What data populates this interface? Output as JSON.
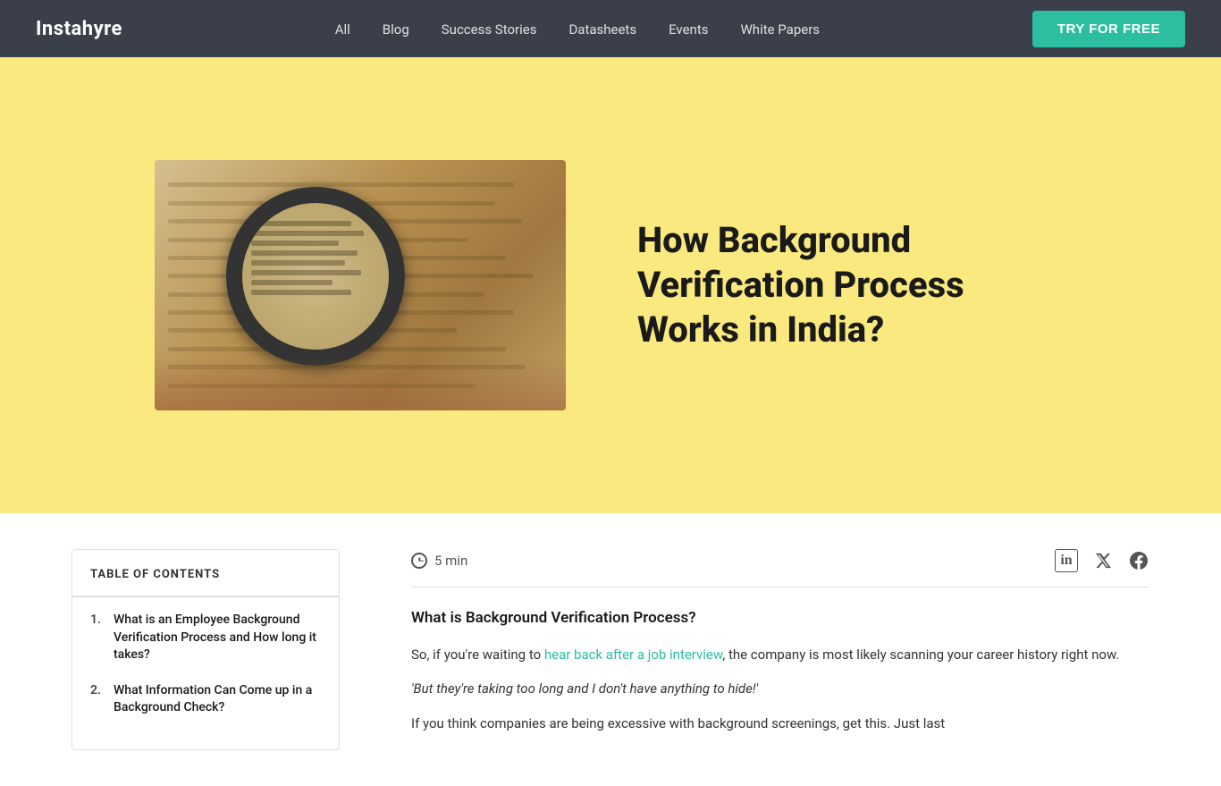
{
  "nav": {
    "logo": "Instahyre",
    "links": [
      {
        "label": "All",
        "id": "all"
      },
      {
        "label": "Blog",
        "id": "blog"
      },
      {
        "label": "Success Stories",
        "id": "success-stories"
      },
      {
        "label": "Datasheets",
        "id": "datasheets"
      },
      {
        "label": "Events",
        "id": "events"
      },
      {
        "label": "White Papers",
        "id": "white-papers"
      }
    ],
    "cta_label": "TRY FOR FREE"
  },
  "hero": {
    "title": "How Background Verification Process Works in India?"
  },
  "toc": {
    "header": "TABLE OF CONTENTS",
    "items": [
      {
        "number": "1.",
        "text": "What is an Employee Background Verification Process and How long it takes?"
      },
      {
        "number": "2.",
        "text": "What Information Can Come up in a Background Check?"
      }
    ]
  },
  "article": {
    "read_time": "5 min",
    "subtitle": "What is Background Verification Process?",
    "paragraph1_pre": "So, if you're waiting to ",
    "paragraph1_link": "hear back after a job interview",
    "paragraph1_post": ", the company is most likely scanning your career history right now.",
    "paragraph2": "'But they're taking too long and I don't have anything to hide!'",
    "paragraph3": "If you think companies are being excessive with background screenings, get this. Just last"
  },
  "social": {
    "linkedin": "in",
    "twitter": "𝕏",
    "facebook": "f"
  }
}
